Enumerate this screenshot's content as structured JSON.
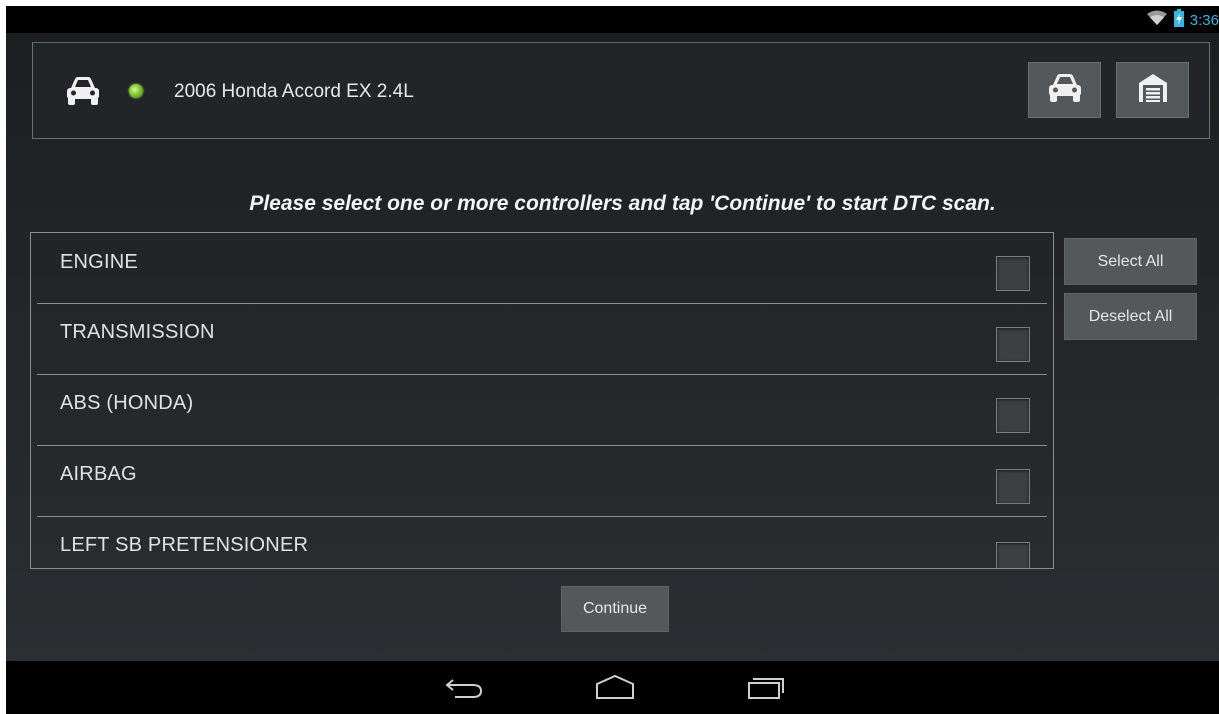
{
  "status_bar": {
    "time": "3:36",
    "icons": [
      "wifi-icon",
      "battery-charging-icon"
    ]
  },
  "vehicle": {
    "name": "2006 Honda Accord EX 2.4L",
    "icon": "car-icon",
    "connection_status_color": "#7ecb2d",
    "buttons": [
      {
        "icon": "car-icon",
        "purpose": "vehicle"
      },
      {
        "icon": "garage-icon",
        "purpose": "garage"
      }
    ]
  },
  "instruction": "Please select one or more controllers and tap 'Continue' to start DTC scan.",
  "controllers": [
    {
      "label": "ENGINE",
      "checked": false
    },
    {
      "label": "TRANSMISSION",
      "checked": false
    },
    {
      "label": "ABS (HONDA)",
      "checked": false
    },
    {
      "label": "AIRBAG",
      "checked": false
    },
    {
      "label": "LEFT SB PRETENSIONER",
      "checked": false
    }
  ],
  "actions": {
    "select_all": "Select All",
    "deselect_all": "Deselect All",
    "continue": "Continue"
  },
  "nav_bar": {
    "icons": [
      "back-icon",
      "home-icon",
      "recent-apps-icon"
    ]
  },
  "colors": {
    "accent": "#33b5e5",
    "button_bg": "#55585b"
  }
}
